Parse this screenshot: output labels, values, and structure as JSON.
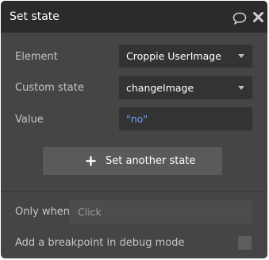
{
  "header": {
    "title": "Set state",
    "icons": [
      "comment-icon",
      "close-icon"
    ]
  },
  "form": {
    "element": {
      "label": "Element",
      "value": "Croppie UserImage"
    },
    "custom_state": {
      "label": "Custom state",
      "value": "changeImage"
    },
    "value": {
      "label": "Value",
      "value": "\"no\""
    }
  },
  "actions": {
    "set_another_label": "Set another state",
    "set_another_icon": "plus-icon"
  },
  "conditions": {
    "only_when_label": "Only when",
    "only_when_placeholder": "Click"
  },
  "debug": {
    "breakpoint_label": "Add a breakpoint in debug mode",
    "breakpoint_checked": false
  },
  "colors": {
    "panel_bg": "#454545",
    "header_bg": "#2b2b2b",
    "field_bg": "#333333",
    "value_text": "#6aa2ff"
  }
}
